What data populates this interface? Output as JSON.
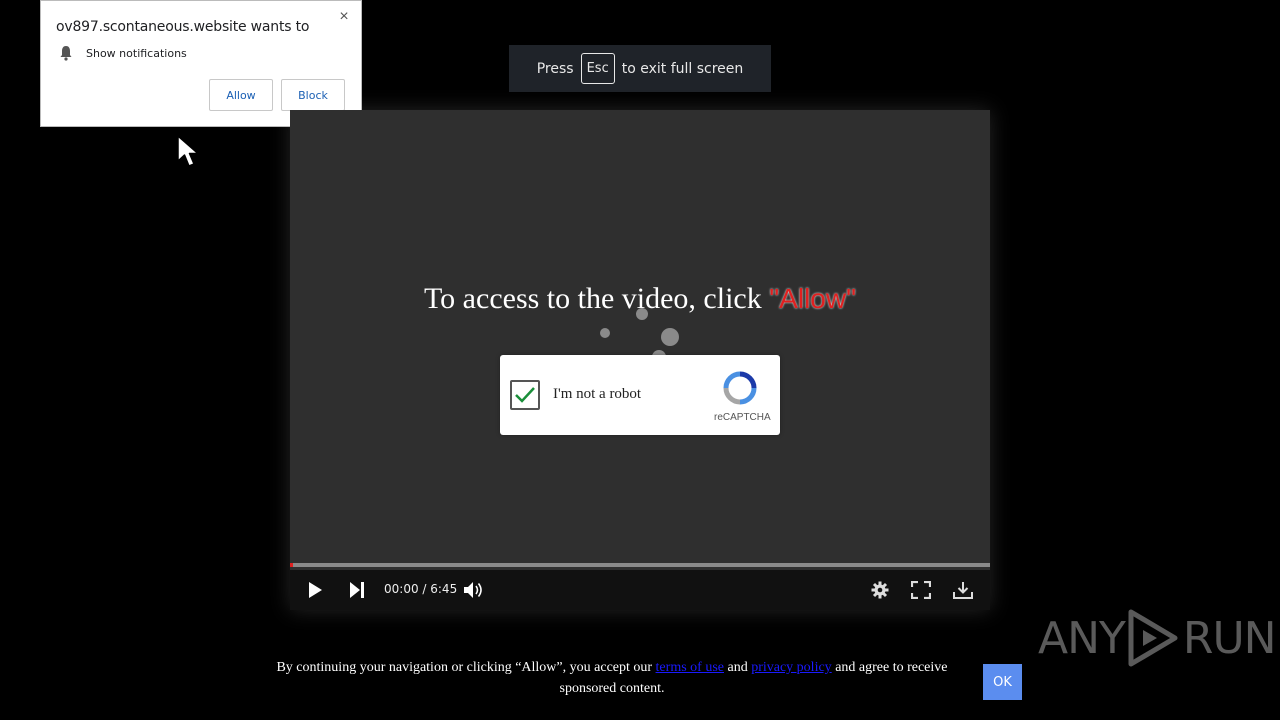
{
  "notification": {
    "title": "ov897.scontaneous.website wants to",
    "close_icon": "×",
    "permission_label": "Show notifications",
    "allow_label": "Allow",
    "block_label": "Block"
  },
  "fullscreen_toast": {
    "prefix": "Press",
    "key": "Esc",
    "suffix": "to exit full screen"
  },
  "player": {
    "headline": "To access to the video, click",
    "headline_accent": "\"Allow\"",
    "captcha": {
      "label": "I'm not a robot",
      "brand": "reCAPTCHA",
      "checked": true
    },
    "time": "00:00 / 6:45",
    "progress_fraction": 0.0
  },
  "consent": {
    "text_before": "By continuing your navigation or clicking “Allow”, you accept our",
    "terms_link": "terms of use",
    "text_middle": "and",
    "privacy_link": "privacy policy",
    "text_after": "and agree to receive sponsored content.",
    "ok_label": "OK"
  },
  "watermark": {
    "left": "ANY",
    "right": "RUN"
  },
  "colors": {
    "accent_red": "#e02020",
    "link_blue": "#1a1aff",
    "ok_button": "#5b8def",
    "check_green": "#1a8f3a"
  }
}
